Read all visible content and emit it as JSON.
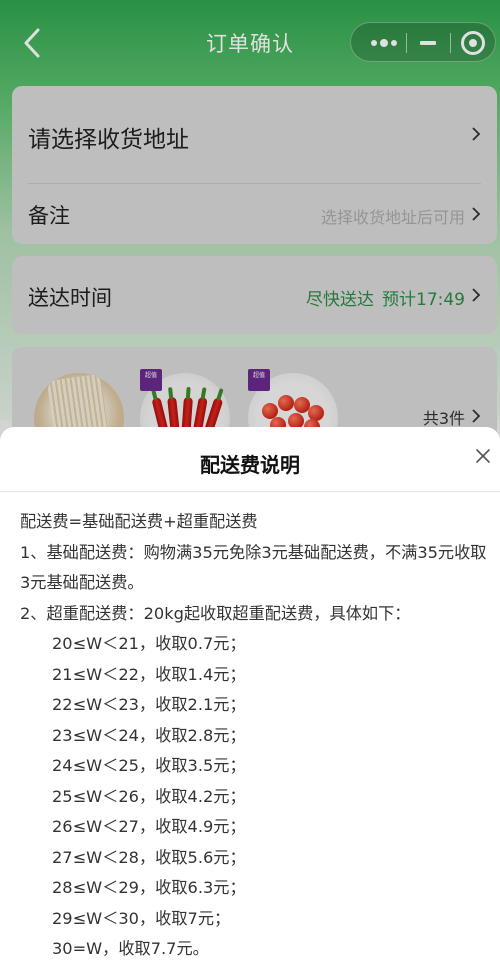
{
  "nav": {
    "title": "订单确认"
  },
  "address_card": {
    "address_label": "请选择收货地址",
    "note_label": "备注",
    "note_hint": "选择收货地址后可用"
  },
  "delivery_card": {
    "label": "送达时间",
    "speed": "尽快送达",
    "estimate": "预计17:49"
  },
  "goods_card": {
    "count_text": "共3件",
    "items": [
      {
        "icon": "noodles-image"
      },
      {
        "icon": "red-pepper-image",
        "badge": "超值"
      },
      {
        "icon": "cherry-tomato-image",
        "badge": "超值"
      }
    ]
  },
  "sheet": {
    "title": "配送费说明",
    "formula": "配送费=基础配送费+超重配送费",
    "rule1": "1、基础配送费：购物满35元免除3元基础配送费，不满35元收取3元基础配送费。",
    "rule2": "2、超重配送费：20kg起收取超重配送费，具体如下：",
    "tiers": [
      "20≤W＜21，收取0.7元；",
      "21≤W＜22，收取1.4元；",
      "22≤W＜23，收取2.1元；",
      "23≤W＜24，收取2.8元；",
      "24≤W＜25，收取3.5元；",
      "25≤W＜26，收取4.2元；",
      "26≤W＜27，收取4.9元；",
      "27≤W＜28，收取5.6元；",
      "28≤W＜29，收取6.3元；",
      "29≤W＜30，收取7元；",
      "30=W，收取7.7元。"
    ]
  },
  "colors": {
    "brand_green": "#2fa54e",
    "time_green": "#2c8a46",
    "badge_purple": "#6a2a8e"
  }
}
